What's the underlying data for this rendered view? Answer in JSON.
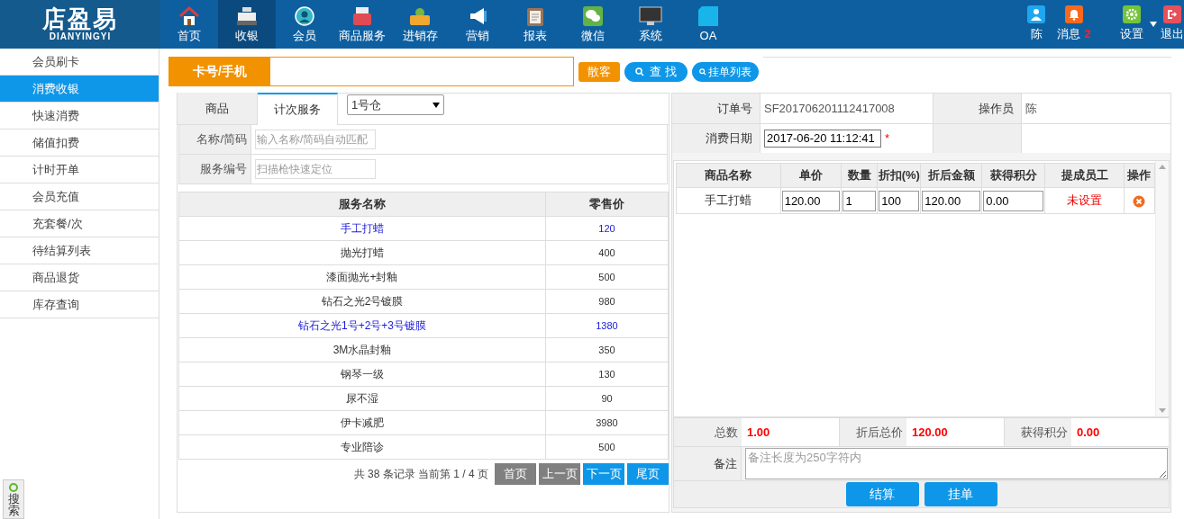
{
  "header": {
    "logo": "店盈易",
    "logo_sub": "DIANYINGYI",
    "nav": [
      {
        "label": "首页",
        "selected": false
      },
      {
        "label": "收银",
        "selected": true
      },
      {
        "label": "会员",
        "selected": false
      },
      {
        "label": "商品服务",
        "selected": false
      },
      {
        "label": "进销存",
        "selected": false
      },
      {
        "label": "营销",
        "selected": false
      },
      {
        "label": "报表",
        "selected": false
      },
      {
        "label": "微信",
        "selected": false
      },
      {
        "label": "系统",
        "selected": false
      },
      {
        "label": "OA",
        "selected": false
      }
    ],
    "user": "陈",
    "messages": "消息",
    "message_count": "2",
    "settings": "设置",
    "logout": "退出"
  },
  "sidebar": {
    "items": [
      {
        "label": "会员刷卡",
        "selected": false
      },
      {
        "label": "消费收银",
        "selected": true
      },
      {
        "label": "快速消费",
        "selected": false
      },
      {
        "label": "储值扣费",
        "selected": false
      },
      {
        "label": "计时开单",
        "selected": false
      },
      {
        "label": "会员充值",
        "selected": false
      },
      {
        "label": "充套餐/次",
        "selected": false
      },
      {
        "label": "待结算列表",
        "selected": false
      },
      {
        "label": "商品退货",
        "selected": false
      },
      {
        "label": "库存查询",
        "selected": false
      }
    ]
  },
  "search_widget": {
    "label": "搜索"
  },
  "card_bar": {
    "label": "卡号/手机",
    "walk_in": "散客",
    "search": "查 找",
    "held_list": "挂单列表"
  },
  "left": {
    "tabs": [
      {
        "label": "商品",
        "selected": false
      },
      {
        "label": "计次服务",
        "selected": true
      }
    ],
    "warehouse": "1号仓",
    "filters": [
      {
        "label": "名称/简码",
        "placeholder": "输入名称/简码自动匹配"
      },
      {
        "label": "服务编号",
        "placeholder": "扫描枪快速定位"
      }
    ],
    "columns": [
      "服务名称",
      "零售价"
    ],
    "rows": [
      {
        "name": "手工打蜡",
        "price": "120",
        "highlighted": true
      },
      {
        "name": "抛光打蜡",
        "price": "400",
        "highlighted": false
      },
      {
        "name": "漆面抛光+封釉",
        "price": "500",
        "highlighted": false
      },
      {
        "name": "钻石之光2号镀膜",
        "price": "980",
        "highlighted": false
      },
      {
        "name": "钻石之光1号+2号+3号镀膜",
        "price": "1380",
        "highlighted": true
      },
      {
        "name": "3M水晶封釉",
        "price": "350",
        "highlighted": false
      },
      {
        "name": "钢琴一级",
        "price": "130",
        "highlighted": false
      },
      {
        "name": "尿不湿",
        "price": "90",
        "highlighted": false
      },
      {
        "name": "伊卡减肥",
        "price": "3980",
        "highlighted": false
      },
      {
        "name": "专业陪诊",
        "price": "500",
        "highlighted": false
      }
    ],
    "pager": {
      "summary": "共 38 条记录 当前第 1 / 4 页",
      "buttons": [
        {
          "label": "首页",
          "disabled": true
        },
        {
          "label": "上一页",
          "disabled": true
        },
        {
          "label": "下一页",
          "disabled": false
        },
        {
          "label": "尾页",
          "disabled": false
        }
      ]
    }
  },
  "right": {
    "order_label": "订单号",
    "order_no": "SF201706201112417008",
    "operator_label": "操作员",
    "operator": "陈",
    "date_label": "消费日期",
    "date": "2017-06-20 11:12:41",
    "required_mark": "*",
    "columns": [
      "商品名称",
      "单价",
      "数量",
      "折扣(%)",
      "折后金额",
      "获得积分",
      "提成员工",
      "操作"
    ],
    "items": [
      {
        "name": "手工打蜡",
        "price": "120.00",
        "qty": "1",
        "discount": "100",
        "amount": "120.00",
        "points": "0.00",
        "staff": "未设置"
      }
    ],
    "totals": [
      {
        "label": "总数",
        "value": "1.00"
      },
      {
        "label": "折后总价",
        "value": "120.00"
      },
      {
        "label": "获得积分",
        "value": "0.00"
      }
    ],
    "note_label": "备注",
    "note_placeholder": "备注长度为250字符内",
    "buttons": [
      "结算",
      "挂单"
    ]
  }
}
